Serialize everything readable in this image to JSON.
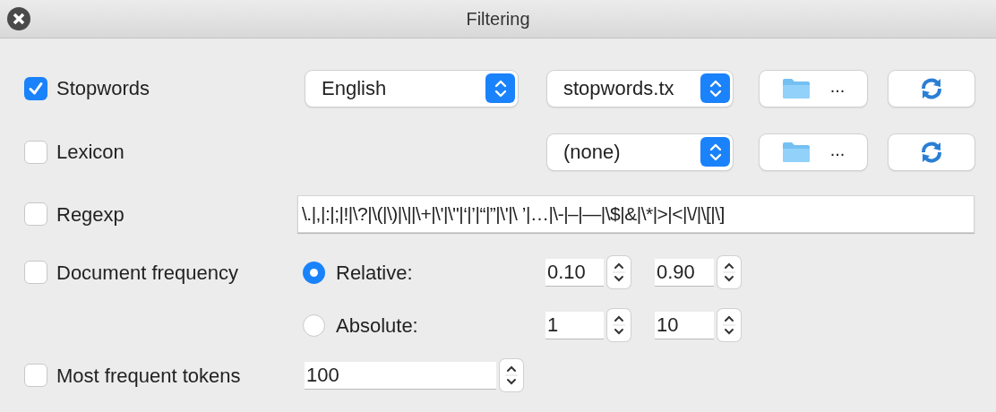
{
  "window": {
    "title": "Filtering"
  },
  "filters": [
    {
      "kind": "stopwords",
      "label": "Stopwords",
      "checked": true,
      "dropdowns": [
        "English",
        "stopwords.tx"
      ],
      "browse_label": "..."
    },
    {
      "kind": "lexicon",
      "label": "Lexicon",
      "checked": false,
      "dropdowns": [
        "(none)"
      ],
      "browse_label": "..."
    },
    {
      "kind": "regexp",
      "label": "Regexp",
      "checked": false,
      "value": "\\.|,|:|;|!|\\?|\\(|\\)|\\||\\+|\\'|\\\"|‘|’|“|”|\\'|\\ ’|…|\\-|–|—|\\$|&|\\*|>|<|\\/|\\[|\\]"
    },
    {
      "kind": "document_frequency",
      "label": "Document frequency",
      "checked": false,
      "options": [
        {
          "label": "Relative:",
          "selected": true,
          "min": "0.10",
          "max": "0.90"
        },
        {
          "label": "Absolute:",
          "selected": false,
          "min": "1",
          "max": "10"
        }
      ]
    },
    {
      "kind": "most_frequent",
      "label": "Most frequent tokens",
      "checked": false,
      "value": "100"
    }
  ]
}
